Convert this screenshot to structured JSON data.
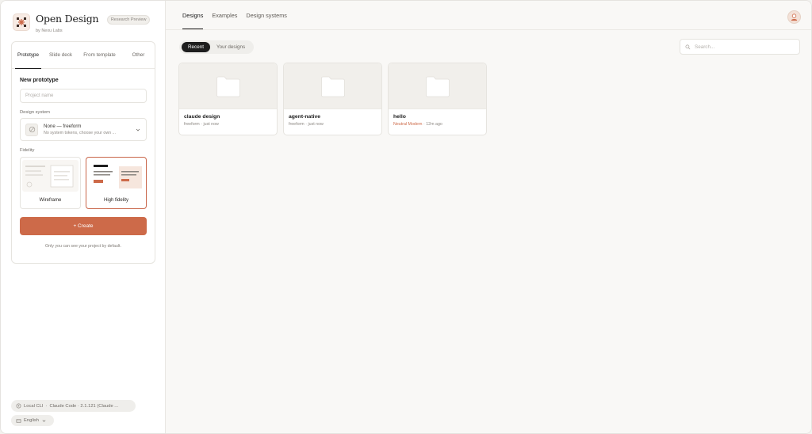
{
  "brand": {
    "title": "Open Design",
    "badge": "Research Preview",
    "subtitle": "by Nexu Labs"
  },
  "sidebar": {
    "tabs": [
      {
        "label": "Prototype",
        "active": true
      },
      {
        "label": "Slide deck",
        "active": false
      },
      {
        "label": "From template",
        "active": false
      },
      {
        "label": "Other",
        "active": false
      }
    ],
    "section_title": "New prototype",
    "project_name_placeholder": "Project name",
    "design_system_label": "Design system",
    "design_system_value": "None — freeform",
    "design_system_hint": "No system tokens, choose your own ...",
    "fidelity_label": "Fidelity",
    "fidelity_options": [
      {
        "label": "Wireframe",
        "selected": false
      },
      {
        "label": "High fidelity",
        "selected": true
      }
    ],
    "create_label": "+ Create",
    "privacy_hint": "Only you can see your project by default."
  },
  "footer": {
    "status_mode": "Local CLI",
    "status_sep": "·",
    "status_agent": "Claude Code · 2.1.121 (Claude ...",
    "language": "English"
  },
  "topnav": {
    "tabs": [
      {
        "label": "Designs",
        "active": true
      },
      {
        "label": "Examples",
        "active": false
      },
      {
        "label": "Design systems",
        "active": false
      }
    ]
  },
  "filters": {
    "segments": [
      {
        "label": "Recent",
        "active": true
      },
      {
        "label": "Your designs",
        "active": false
      }
    ],
    "search_placeholder": "Search..."
  },
  "projects": [
    {
      "name": "claude design",
      "meta_tag": "",
      "meta_prefix": "freeform",
      "meta_time": "just now"
    },
    {
      "name": "agent-native",
      "meta_tag": "",
      "meta_prefix": "freeform",
      "meta_time": "just now"
    },
    {
      "name": "hello",
      "meta_tag": "Neutral Modern",
      "meta_prefix": "",
      "meta_time": "12m ago"
    }
  ],
  "colors": {
    "accent": "#cd6a49",
    "dark": "#1e1e1e",
    "background": "#f9f8f6"
  }
}
